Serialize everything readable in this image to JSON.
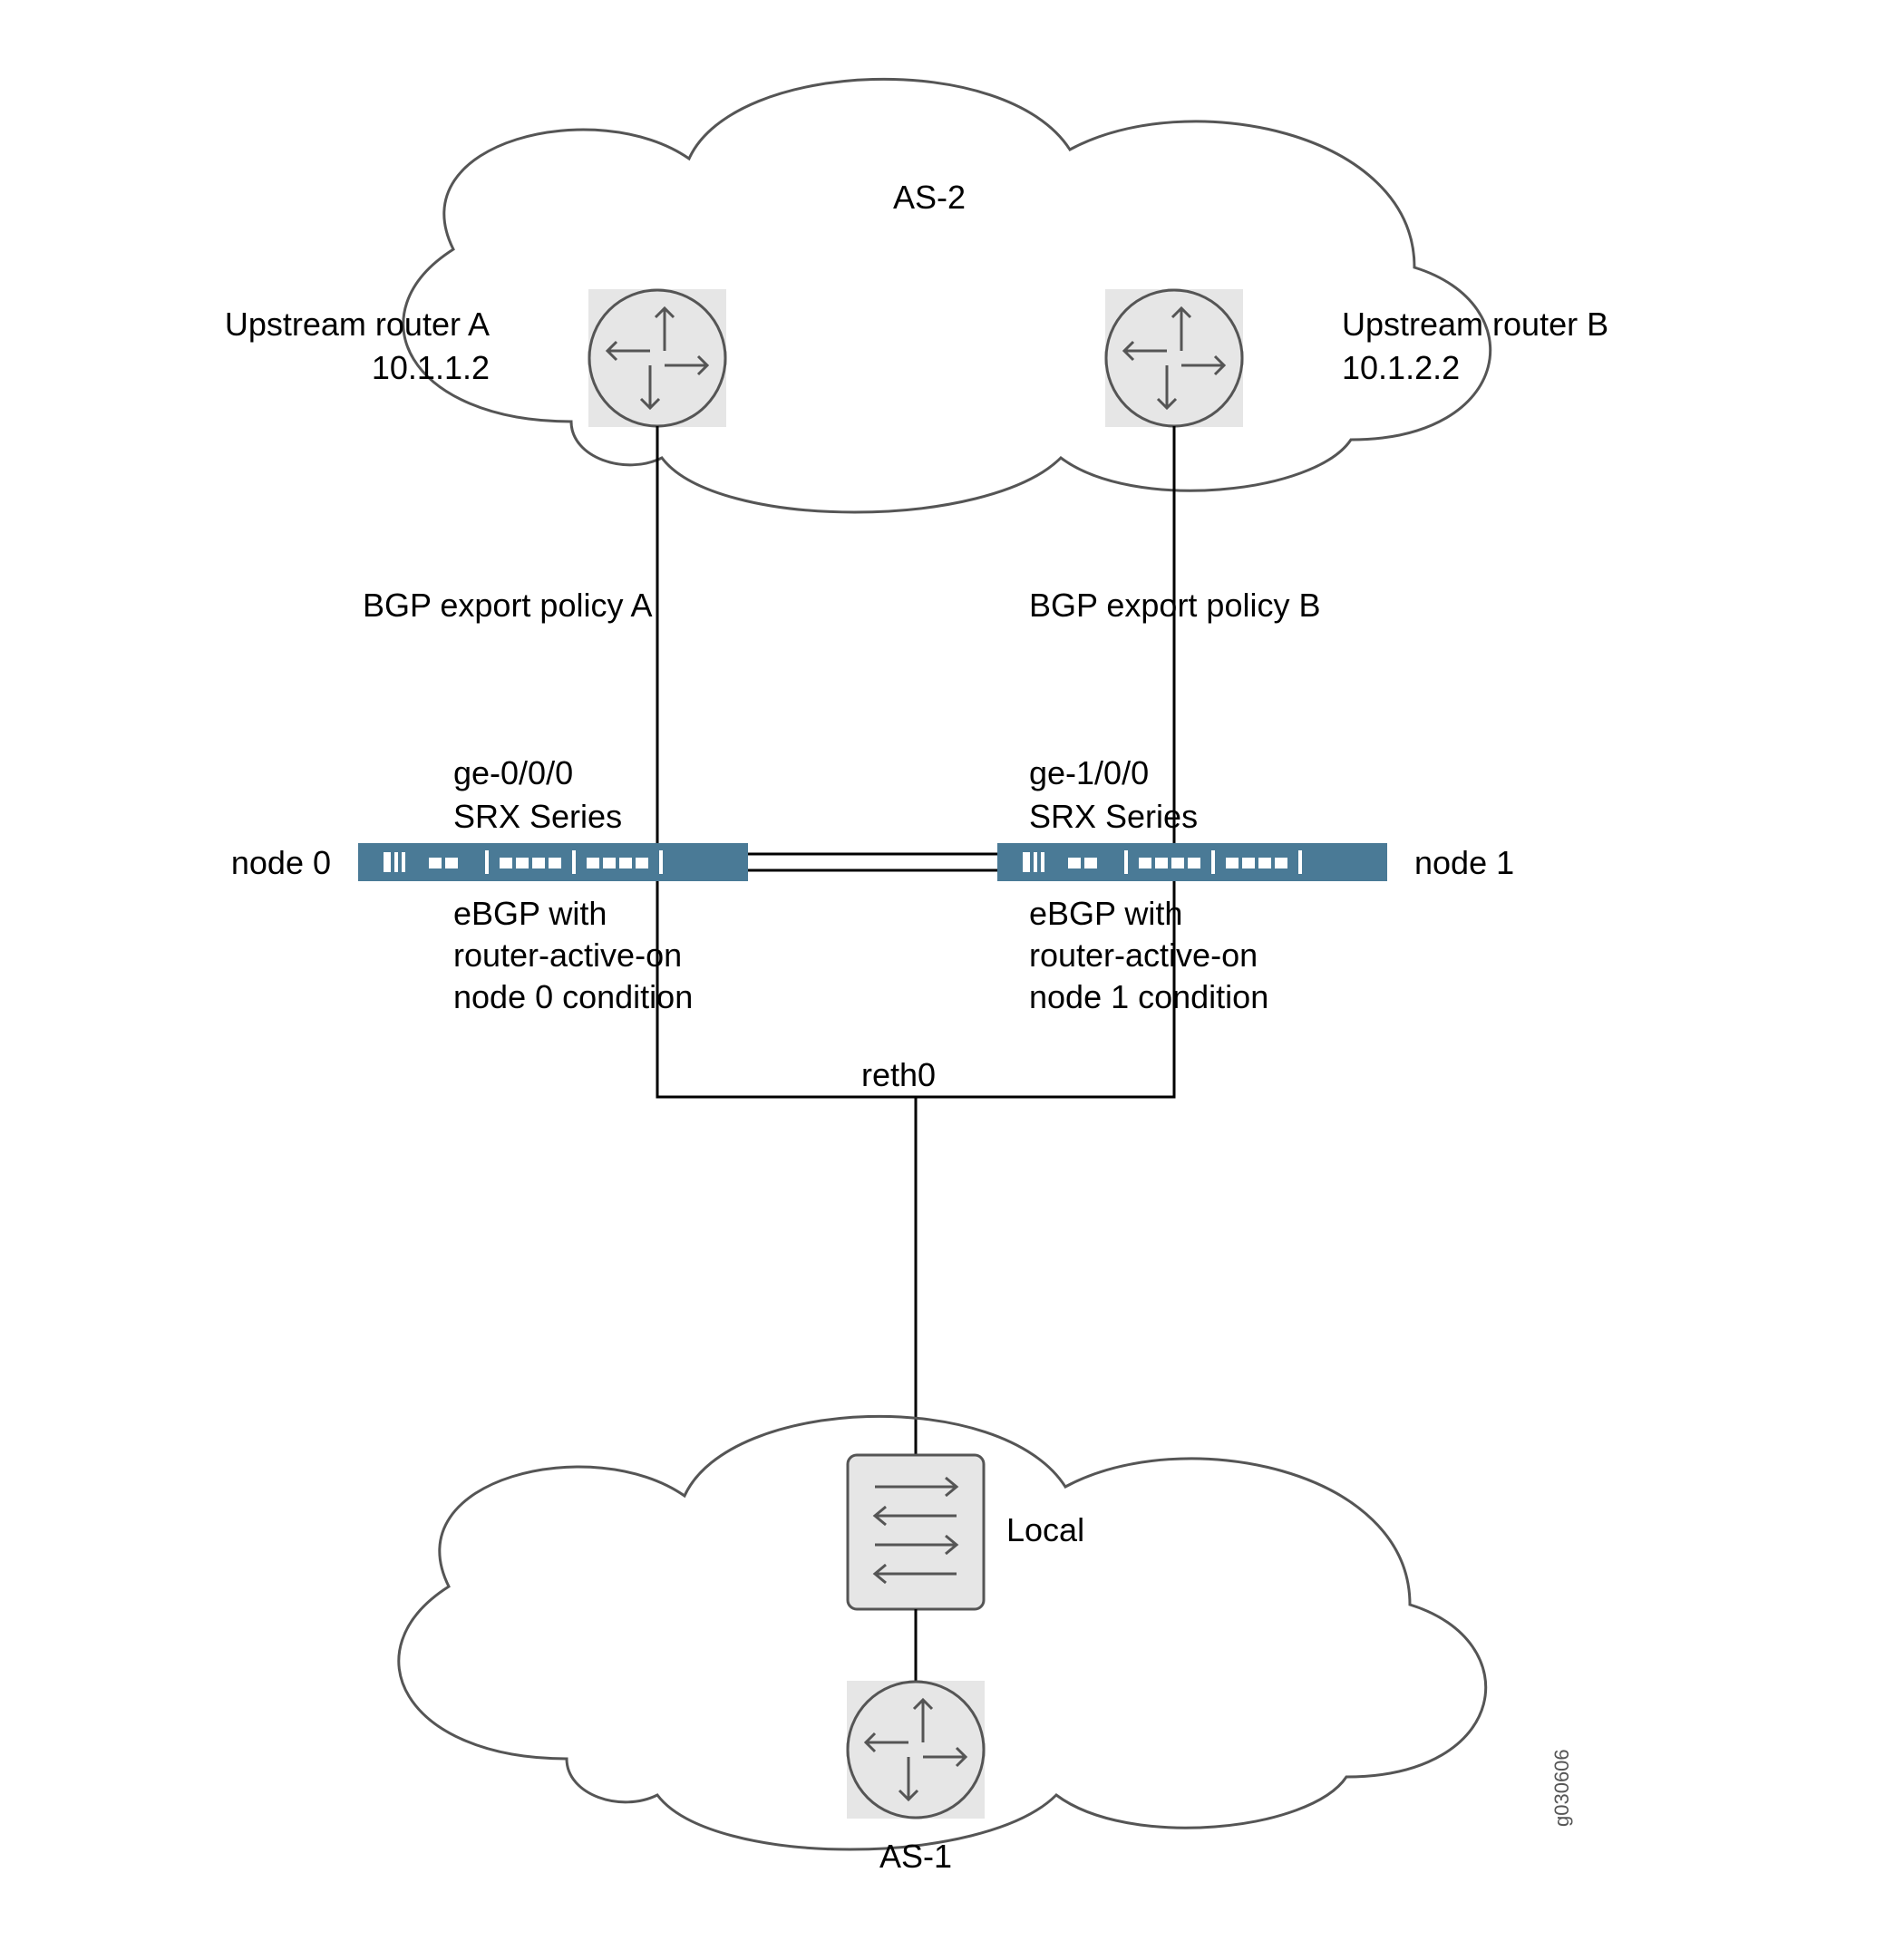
{
  "cloud_top": {
    "title": "AS-2"
  },
  "router_a": {
    "label_line1": "Upstream router A",
    "label_line2": "10.1.1.2"
  },
  "router_b": {
    "label_line1": "Upstream router B",
    "label_line2": "10.1.2.2"
  },
  "link_a": {
    "policy": "BGP export policy A"
  },
  "link_b": {
    "policy": "BGP export policy B"
  },
  "node0": {
    "name": "node 0",
    "iface": "ge-0/0/0",
    "series": "SRX Series",
    "ebgp_line1": "eBGP with",
    "ebgp_line2": "router-active-on",
    "ebgp_line3": "node 0 condition"
  },
  "node1": {
    "name": "node 1",
    "iface": "ge-1/0/0",
    "series": "SRX Series",
    "ebgp_line1": "eBGP with",
    "ebgp_line2": "router-active-on",
    "ebgp_line3": "node 1 condition"
  },
  "reth": {
    "label": "reth0"
  },
  "switch_local": {
    "label": "Local"
  },
  "cloud_bottom": {
    "title": "AS-1"
  },
  "image_id": "g030606"
}
